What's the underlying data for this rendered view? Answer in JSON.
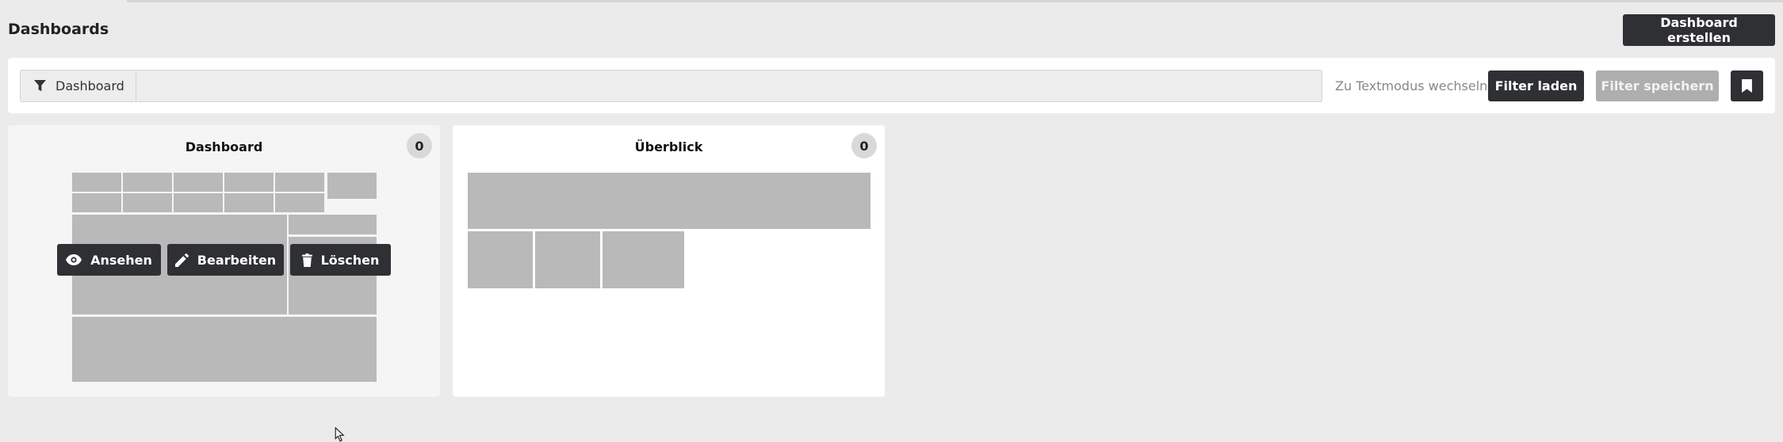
{
  "header": {
    "title": "Dashboards",
    "create_button": "Dashboard erstellen"
  },
  "filter_bar": {
    "chip_label": "Dashboard",
    "chip_icon": "filter-icon",
    "input_value": "",
    "text_mode_link": "Zu Textmodus wechseln",
    "load_button": "Filter laden",
    "save_button": "Filter speichern",
    "bookmark_icon": "bookmark-icon"
  },
  "dashboards": [
    {
      "title": "Dashboard",
      "count": "0",
      "actions": {
        "view": "Ansehen",
        "edit": "Bearbeiten",
        "delete": "Löschen"
      }
    },
    {
      "title": "Überblick",
      "count": "0"
    }
  ],
  "colors": {
    "page_bg": "#ebebeb",
    "dark_button": "#2f3033",
    "disabled_button": "#aeaeae",
    "tile": "#b9b9b9"
  }
}
